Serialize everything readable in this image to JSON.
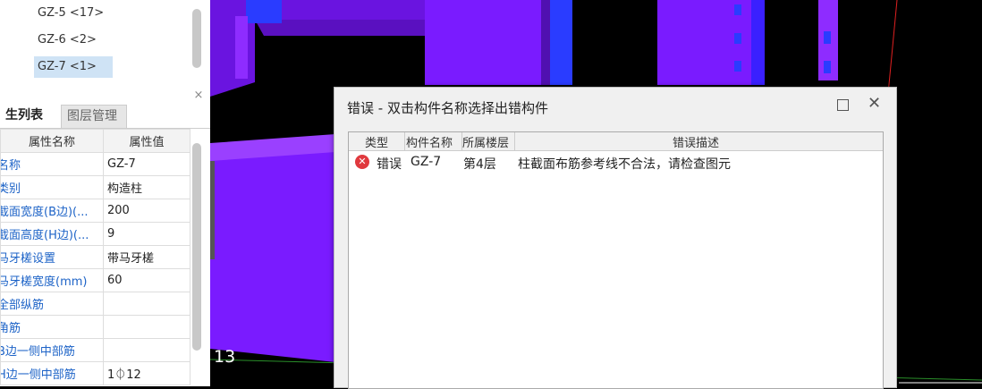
{
  "tree": {
    "items": [
      {
        "label": "GZ-5 <17>",
        "selected": false
      },
      {
        "label": "GZ-6 <2>",
        "selected": false
      },
      {
        "label": "GZ-7 <1>",
        "selected": true
      }
    ]
  },
  "panel": {
    "close_label": "×"
  },
  "tabs": {
    "properties": "生列表",
    "layers": "图层管理"
  },
  "properties": {
    "header_name": "属性名称",
    "header_value": "属性值",
    "rows": [
      {
        "name": "名称",
        "value": "GZ-7"
      },
      {
        "name": "类别",
        "value": "构造柱"
      },
      {
        "name": "截面宽度(B边)(...",
        "value": "200"
      },
      {
        "name": "截面高度(H边)(...",
        "value": "9"
      },
      {
        "name": "马牙槎设置",
        "value": "带马牙槎"
      },
      {
        "name": "马牙槎宽度(mm)",
        "value": "60"
      },
      {
        "name": "全部纵筋",
        "value": ""
      },
      {
        "name": "角筋",
        "value": ""
      },
      {
        "name": "B边一侧中部筋",
        "value": ""
      },
      {
        "name": "H边一侧中部筋",
        "value": "1⏀12"
      }
    ]
  },
  "viewport": {
    "view_number": "13"
  },
  "dialog": {
    "title": "错误 - 双击构件名称选择出错构件",
    "maximize_label": "",
    "close_label": "✕",
    "columns": {
      "type": "类型",
      "name": "构件名称",
      "floor": "所属楼层",
      "desc": "错误描述"
    },
    "rows": [
      {
        "icon": "error-icon",
        "type": "错误",
        "name": "GZ-7",
        "floor": "第4层",
        "desc": "柱截面布筋参考线不合法，请检查图元"
      }
    ]
  },
  "colors": {
    "accent": "#1d63c7",
    "error": "#e0393e",
    "purple": "#7a1bff",
    "blue": "#2a4bff"
  }
}
